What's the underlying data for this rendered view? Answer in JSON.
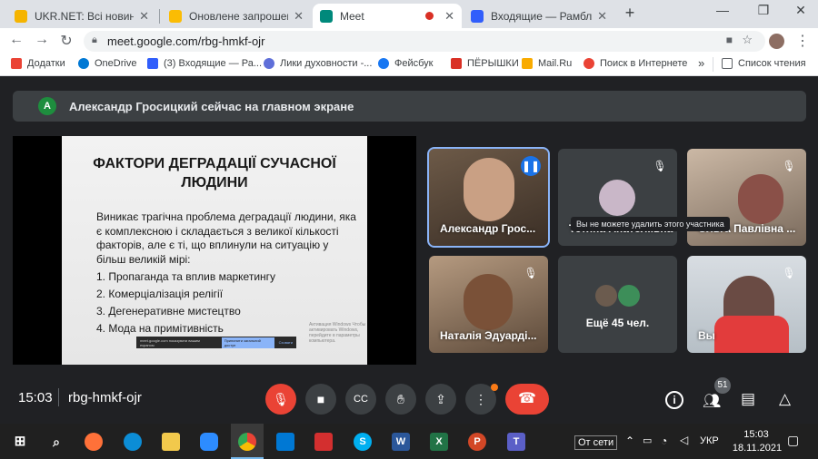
{
  "browser": {
    "tabs": [
      {
        "title": "UKR.NET: Всі новини Укр",
        "icon": "ukrnet-icon",
        "color": "#f5b400"
      },
      {
        "title": "Оновлене запрошення:",
        "icon": "calendar-icon",
        "color": "#fbbc04"
      },
      {
        "title": "Meet",
        "icon": "meet-icon",
        "color": "#00897b",
        "recording": true
      },
      {
        "title": "Входящие — Рамблер/п",
        "icon": "mail-icon",
        "color": "#315efb"
      }
    ],
    "new_tab": "+",
    "window": {
      "minimize": "—",
      "maximize": "❐",
      "close": "✕"
    },
    "url": "meet.google.com/rbg-hmkf-ojr",
    "bookmarks": [
      {
        "label": "Додатки",
        "color": "#ea4335"
      },
      {
        "label": "OneDrive",
        "color": "#0078d4"
      },
      {
        "label": "(3) Входящие — Ра...",
        "color": "#315efb"
      },
      {
        "label": "Лики духовности -...",
        "color": "#5f6fd9"
      },
      {
        "label": "Фейсбук",
        "color": "#1877f2"
      },
      {
        "label": "ПЁРЫШКИ",
        "color": "#d93025"
      },
      {
        "label": "Mail.Ru",
        "color": "#f9ab00"
      },
      {
        "label": "Поиск в Интернете",
        "color": "#ea4335"
      }
    ],
    "bookmarks_more": "»",
    "reading_list": "Список чтения"
  },
  "meet": {
    "banner": {
      "avatar": "А",
      "text": "Александр Гросицкий сейчас на главном экране"
    },
    "slide": {
      "title": "ФАКТОРИ ДЕГРАДАЦІЇ СУЧАСНОЇ ЛЮДИНИ",
      "body": "Виникає трагічна проблема деградації людини, яка є комплексною і складається з великої кількості факторів, але є ті, що вплинули на ситуацію у більш великій мірі:",
      "items": [
        "1. Пропаганда та вплив маркетингу",
        "2. Комерціалізація релігії",
        "3. Дегенеративне мистецтво",
        "4. Мода на примітивність"
      ],
      "share_text": "meet.google.com показувати вашим екраном",
      "share_button": "Припинити загальний доступ",
      "share_hide": "Сховати",
      "watermark": "Активация Windows Чтобы активировать Windows, перейдите в параметры компьютера."
    },
    "tiles": [
      {
        "name": "Александр Грос...",
        "mic": "speaking"
      },
      {
        "name": "Тетяна Анатоліївна",
        "mic": "muted"
      },
      {
        "name": "Ольга Павлівна ...",
        "mic": "muted"
      },
      {
        "name": "Наталія Эдуарді...",
        "mic": "muted"
      },
      {
        "name": "Ещё 45 чел.",
        "mic": "muted"
      },
      {
        "name": "Вы",
        "mic": "muted"
      }
    ],
    "tooltip": "Вы не можете удалить этого участника",
    "time": "15:03",
    "meeting_code": "rbg-hmkf-ojr",
    "participants_count": "51",
    "accent": "#8ab4f8",
    "end_call_color": "#ea4335"
  },
  "taskbar": {
    "offline": "От сети",
    "lang": "УКР",
    "time": "15:03",
    "date": "18.11.2021"
  }
}
